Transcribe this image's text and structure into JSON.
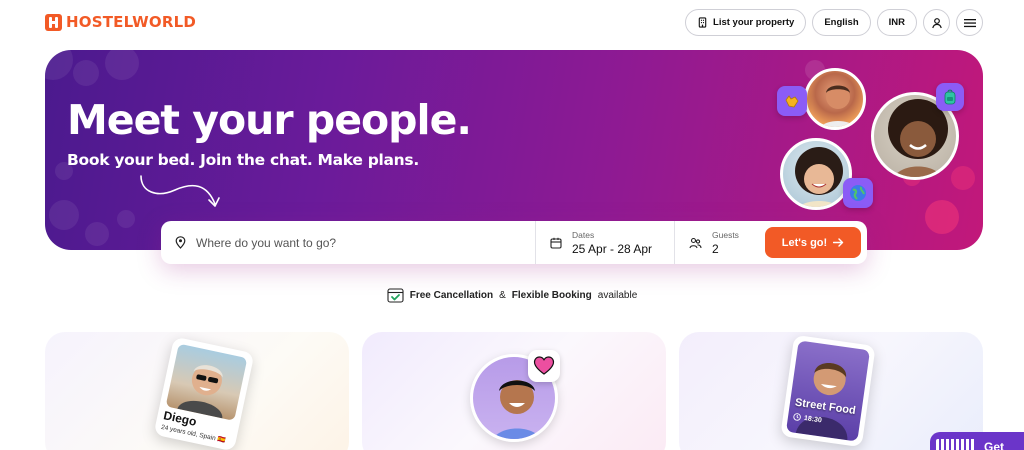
{
  "header": {
    "brand": "HOSTELWORLD",
    "list_property": "List your property",
    "language": "English",
    "currency": "INR"
  },
  "hero": {
    "title": "Meet your people.",
    "subtitle": "Book your bed. Join the chat. Make plans."
  },
  "search": {
    "destination_placeholder": "Where do you want to go?",
    "dates_label": "Dates",
    "dates_value": "25 Apr - 28 Apr",
    "guests_label": "Guests",
    "guests_value": "2",
    "go_button": "Let's go!"
  },
  "benefit": {
    "free_cancellation": "Free Cancellation",
    "amp": "&",
    "flexible_booking": "Flexible Booking",
    "available": "available"
  },
  "cards": {
    "card1_name": "Diego",
    "card1_details": "24 years old, Spain 🇪🇸",
    "card3_title": "Street Food",
    "card3_time": "18:30"
  },
  "chat_widget": {
    "label": "Get"
  },
  "colors": {
    "brand_orange": "#f25a26",
    "hero_purple": "#6a1b9a",
    "hero_magenta": "#c2187a",
    "badge_purple": "#8b5cf6"
  }
}
